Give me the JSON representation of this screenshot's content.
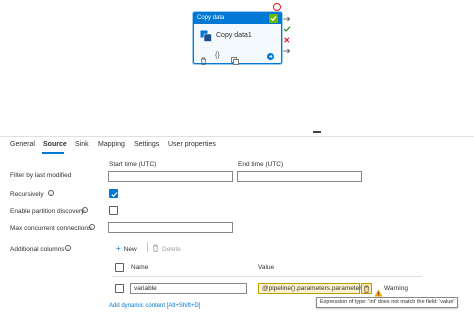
{
  "activity": {
    "type_label": "Copy data",
    "name": "Copy data1",
    "toolbar_glyphs": [
      "{}",
      ""
    ]
  },
  "tabs": [
    {
      "label": "General"
    },
    {
      "label": "Source"
    },
    {
      "label": "Sink"
    },
    {
      "label": "Mapping"
    },
    {
      "label": "Settings"
    },
    {
      "label": "User properties"
    }
  ],
  "active_tab": "Source",
  "form": {
    "filter_label": "Filter by last modified",
    "start_time_label": "Start time (UTC)",
    "end_time_label": "End time (UTC)",
    "start_time_value": "",
    "end_time_value": "",
    "recursively_label": "Recursively",
    "recursively_checked": true,
    "partition_label": "Enable partition discovery",
    "partition_checked": false,
    "max_conn_label": "Max concurrent connections",
    "max_conn_value": "",
    "additional_columns_label": "Additional columns",
    "info_glyph": "i"
  },
  "commands": {
    "new_label": "New",
    "delete_label": "Delete",
    "new_glyph": "+"
  },
  "columns_table": {
    "name_header": "Name",
    "value_header": "Value",
    "rows": [
      {
        "name": "variable",
        "value": "@pipeline().parameters.parameter"
      }
    ]
  },
  "warning_label": "Warning",
  "add_dynamic_content_link": "Add dynamic content [Alt+Shift+D]",
  "tooltip_text": "Expression of type: 'int' does not match the field: 'value'",
  "colors": {
    "accent": "#0078d4",
    "success": "#6bb700",
    "error": "#e81123",
    "warning": "#f4a100"
  },
  "icons": [
    "check-icon",
    "copy-data-icon",
    "trash-icon",
    "braces-icon",
    "copy-icon",
    "go-arrow-icon",
    "success-arrow-icon",
    "completion-arrow-icon",
    "fail-arrow-icon",
    "skip-arrow-icon",
    "info-icon",
    "plus-icon",
    "delete-icon",
    "warning-icon"
  ]
}
